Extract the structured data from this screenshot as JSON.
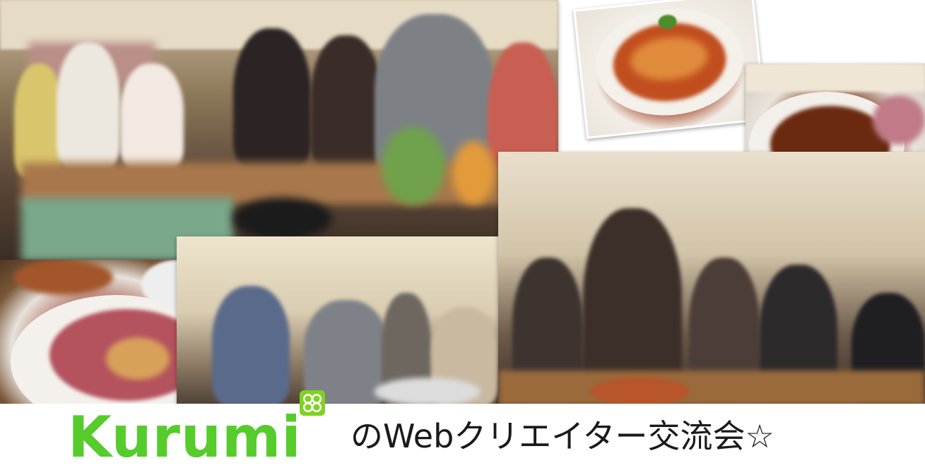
{
  "banner": {
    "logo": "Kurumi",
    "tagline": "のWebクリエイター交流会☆"
  },
  "colors": {
    "logo_green": "#56cc2c",
    "clover_green": "#7ed321",
    "tagline_text": "#1a1a1a",
    "background": "#ffffff"
  },
  "icons": {
    "clover": "four-leaf-clover-icon"
  },
  "photos": [
    "party-main",
    "pasta-dish",
    "chicken-dish",
    "roast-beef-dish",
    "group-middle",
    "group-right"
  ]
}
